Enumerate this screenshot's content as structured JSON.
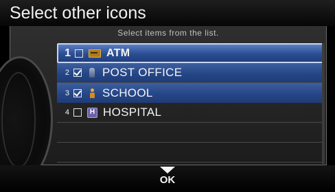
{
  "header": {
    "title": "Select other icons"
  },
  "panel": {
    "subtitle": "Select items from the list."
  },
  "list": [
    {
      "num": "1",
      "label": "ATM",
      "checked": false,
      "icon": "atm-icon"
    },
    {
      "num": "2",
      "label": "POST OFFICE",
      "checked": true,
      "icon": "post-office-icon"
    },
    {
      "num": "3",
      "label": "SCHOOL",
      "checked": true,
      "icon": "school-icon"
    },
    {
      "num": "4",
      "label": "HOSPITAL",
      "checked": false,
      "icon": "hospital-icon"
    }
  ],
  "footer": {
    "ok_label": "OK"
  },
  "icons": {
    "hospital_glyph": "H"
  },
  "colors": {
    "selection": "#2b4d92",
    "highlight_border": "#c9d6f5"
  }
}
